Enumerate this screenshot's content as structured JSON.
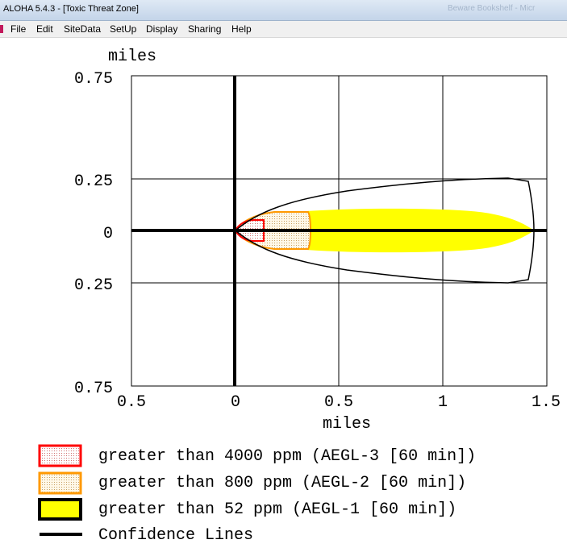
{
  "window": {
    "title": "ALOHA 5.4.3 - [Toxic Threat Zone]",
    "ghost_title": "Beware Bookshelf - Micr"
  },
  "menu": {
    "items": [
      "File",
      "Edit",
      "SiteData",
      "SetUp",
      "Display",
      "Sharing",
      "Help"
    ]
  },
  "plot": {
    "y_unit": "miles",
    "x_unit": "miles",
    "y_ticks": [
      "0.75",
      "0.25",
      "0",
      "0.25",
      "0.75"
    ],
    "x_ticks": [
      "0.5",
      "0",
      "0.5",
      "1",
      "1.5"
    ]
  },
  "chart_data": {
    "type": "area",
    "x_label": "miles",
    "y_label": "miles",
    "xlim": [
      -0.5,
      1.5
    ],
    "ylim": [
      -0.75,
      0.75
    ],
    "y_tick_values": [
      0.75,
      0.25,
      0,
      -0.25,
      -0.75
    ],
    "x_tick_values": [
      -0.5,
      0,
      0.5,
      1,
      1.5
    ],
    "grid": true,
    "zones": [
      {
        "name": "greater than 52 ppm (AEGL-1 [60 min])",
        "color": "#ffff00",
        "downwind_extent_miles": 1.45,
        "max_halfwidth_miles": 0.1
      },
      {
        "name": "greater than 800 ppm (AEGL-2 [60 min])",
        "color": "#ff9900",
        "downwind_extent_miles": 0.37,
        "max_halfwidth_miles": 0.09
      },
      {
        "name": "greater than 4000 ppm (AEGL-3 [60 min])",
        "color": "#ff0000",
        "downwind_extent_miles": 0.14,
        "max_halfwidth_miles": 0.05
      }
    ],
    "confidence_lines": {
      "downwind_extent_miles": 1.45,
      "max_halfwidth_miles": 0.25
    }
  },
  "legend": {
    "items": [
      {
        "label": "greater than 4000 ppm (AEGL-3 [60 min])",
        "kind": "red"
      },
      {
        "label": "greater than 800 ppm (AEGL-2 [60 min])",
        "kind": "orange"
      },
      {
        "label": "greater than 52 ppm (AEGL-1 [60 min])",
        "kind": "yellow"
      },
      {
        "label": "Confidence Lines",
        "kind": "line"
      }
    ]
  }
}
